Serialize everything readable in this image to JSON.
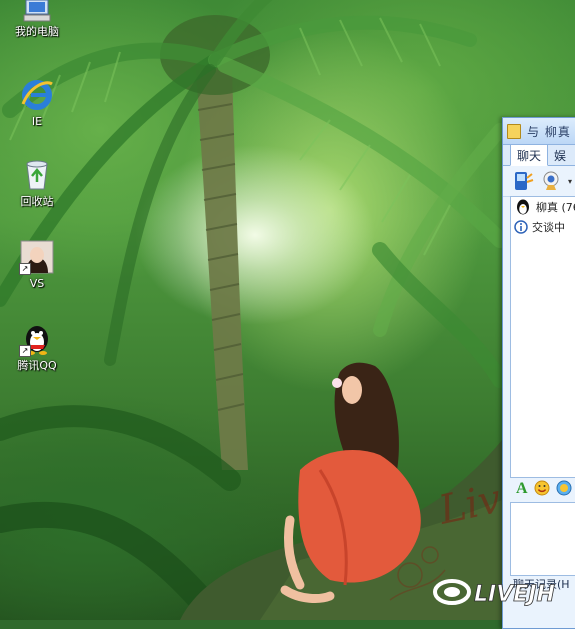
{
  "desktop": {
    "icons": [
      {
        "label": "我的电脑",
        "icon": "my-computer-icon"
      },
      {
        "label": "IE",
        "icon": "internet-explorer-icon"
      },
      {
        "label": "回收站",
        "icon": "recycle-bin-icon"
      },
      {
        "label": "VS",
        "icon": "photo-shortcut-icon"
      },
      {
        "label": "腾讯QQ",
        "icon": "qq-penguin-icon"
      }
    ]
  },
  "chat_window": {
    "title": "与 柳真",
    "tabs": [
      {
        "label": "聊天",
        "active": true
      },
      {
        "label": "娱"
      }
    ],
    "contact_line": "柳真 (76",
    "status_line": "交谈中",
    "history_button": "聊天记录(H"
  },
  "colors": {
    "window_border": "#6f9bd3",
    "titlebar": "#bcd7f6",
    "font_green": "#2e9a2e"
  }
}
